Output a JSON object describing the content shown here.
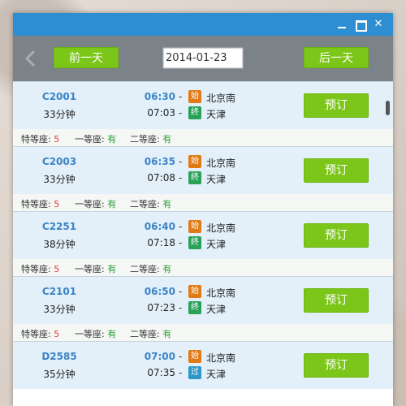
{
  "window": {
    "controls": {
      "minimize_icon": "minimize-icon",
      "maximize_icon": "maximize-icon",
      "close_symbol": "✕"
    }
  },
  "toolbar": {
    "back_icon": "chevron-left-icon",
    "prev_day_label": "前一天",
    "date_value": "2014-01-23",
    "next_day_label": "后一天"
  },
  "trains": [
    {
      "train_no": "C2001",
      "duration": "33分钟",
      "dep_time": "06:30",
      "arr_time": "07:03",
      "dep_badge": "始",
      "arr_badge": "终",
      "from": "北京南",
      "to": "天津",
      "book_label": "预订",
      "seats": [
        {
          "label": "特等座:",
          "count": "5",
          "status": "red"
        },
        {
          "label": "一等座:",
          "count": "有",
          "status": "green"
        },
        {
          "label": "二等座:",
          "count": "有",
          "status": "green"
        }
      ]
    },
    {
      "train_no": "C2003",
      "duration": "33分钟",
      "dep_time": "06:35",
      "arr_time": "07:08",
      "dep_badge": "始",
      "arr_badge": "终",
      "from": "北京南",
      "to": "天津",
      "book_label": "预订",
      "seats": [
        {
          "label": "特等座:",
          "count": "5",
          "status": "red"
        },
        {
          "label": "一等座:",
          "count": "有",
          "status": "green"
        },
        {
          "label": "二等座:",
          "count": "有",
          "status": "green"
        }
      ]
    },
    {
      "train_no": "C2251",
      "duration": "38分钟",
      "dep_time": "06:40",
      "arr_time": "07:18",
      "dep_badge": "始",
      "arr_badge": "终",
      "from": "北京南",
      "to": "天津",
      "book_label": "预订",
      "seats": [
        {
          "label": "特等座:",
          "count": "5",
          "status": "red"
        },
        {
          "label": "一等座:",
          "count": "有",
          "status": "green"
        },
        {
          "label": "二等座:",
          "count": "有",
          "status": "green"
        }
      ]
    },
    {
      "train_no": "C2101",
      "duration": "33分钟",
      "dep_time": "06:50",
      "arr_time": "07:23",
      "dep_badge": "始",
      "arr_badge": "终",
      "from": "北京南",
      "to": "天津",
      "book_label": "预订",
      "seats": [
        {
          "label": "特等座:",
          "count": "5",
          "status": "red"
        },
        {
          "label": "一等座:",
          "count": "有",
          "status": "green"
        },
        {
          "label": "二等座:",
          "count": "有",
          "status": "green"
        }
      ]
    },
    {
      "train_no": "D2585",
      "duration": "35分钟",
      "dep_time": "07:00",
      "arr_time": "07:35",
      "dep_badge": "始",
      "arr_badge": "过",
      "from": "北京南",
      "to": "天津",
      "book_label": "预订",
      "seats": []
    }
  ],
  "colors": {
    "titlebar": "#2d8fd1",
    "toolbar": "#7b8288",
    "accent_green": "#7cc619",
    "train_no_blue": "#3b83c6",
    "badge_start": "#e07a14",
    "badge_end": "#2aa159",
    "badge_pass": "#2d97c8",
    "seat_red": "#e33a3a",
    "seat_green": "#2e9e38"
  }
}
